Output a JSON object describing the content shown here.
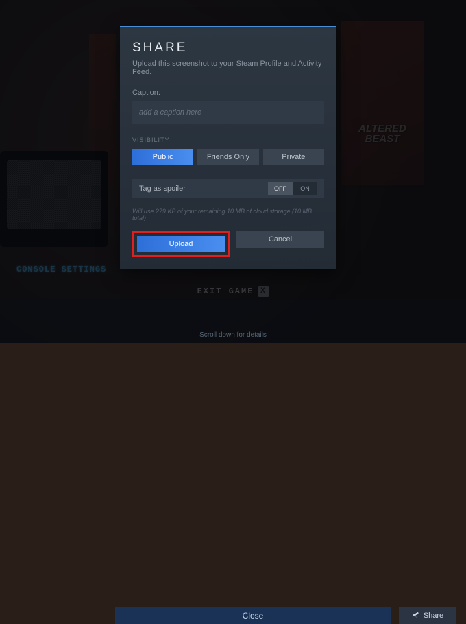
{
  "background": {
    "poster_right_text": "ALTERED BEAST",
    "console_settings": "CONSOLE SETTINGS",
    "exit_game": "EXIT GAME"
  },
  "dialog": {
    "title": "SHARE",
    "subtitle": "Upload this screenshot to your Steam Profile and Activity Feed.",
    "caption_label": "Caption:",
    "caption_placeholder": "add a caption here",
    "caption_value": "",
    "visibility_label": "VISIBILITY",
    "visibility": {
      "public": "Public",
      "friends": "Friends Only",
      "private": "Private",
      "selected": "public"
    },
    "spoiler_label": "Tag as spoiler",
    "spoiler_toggle": {
      "off": "OFF",
      "on": "ON",
      "selected": "off"
    },
    "storage_note": "Will use 279 KB of your remaining 10 MB of cloud storage (10 MB total)",
    "upload": "Upload",
    "cancel": "Cancel"
  },
  "footer": {
    "close": "Close",
    "share": "Share",
    "scroll_hint": "Scroll down for details"
  }
}
